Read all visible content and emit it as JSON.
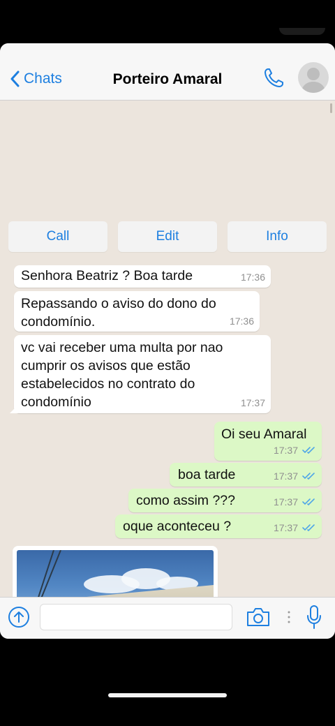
{
  "header": {
    "back_label": "Chats",
    "title": "Porteiro Amaral"
  },
  "actions": {
    "call": "Call",
    "edit": "Edit",
    "info": "Info"
  },
  "messages": [
    {
      "direction": "incoming",
      "text": "Senhora Beatriz ? Boa tarde",
      "time": "17:36"
    },
    {
      "direction": "incoming",
      "text": "Repassando o aviso do dono do\ncondomínio.",
      "time": "17:36"
    },
    {
      "direction": "incoming",
      "text": "vc vai receber uma multa por nao\ncumprir os avisos que estão\nestabelecidos no contrato do\ncondomínio",
      "time": "17:37"
    },
    {
      "direction": "outgoing",
      "text": "Oi seu Amaral",
      "time": "17:37",
      "status": "read"
    },
    {
      "direction": "outgoing",
      "text": "boa tarde",
      "time": "17:37",
      "status": "read"
    },
    {
      "direction": "outgoing",
      "text": "como assim ???",
      "time": "17:37",
      "status": "read"
    },
    {
      "direction": "outgoing",
      "text": "oque aconteceu ?",
      "time": "17:37",
      "status": "read"
    }
  ],
  "composer": {
    "placeholder": ""
  },
  "colors": {
    "accent": "#1d7fe0",
    "chat_background": "#ece5dd",
    "incoming_bubble": "#ffffff",
    "outgoing_bubble": "#dcf8c6",
    "read_ticks": "#4fa6e8"
  },
  "icons": {
    "back": "chevron-left-icon",
    "call": "phone-icon",
    "upload": "arrow-up-circle-icon",
    "camera": "camera-icon",
    "mic": "microphone-icon",
    "read_status": "double-check-icon"
  }
}
